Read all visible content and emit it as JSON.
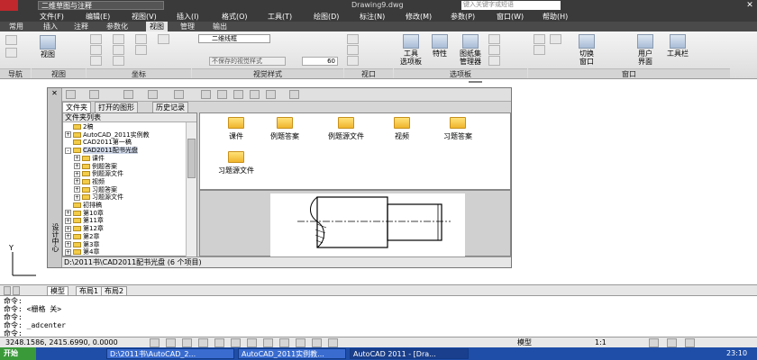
{
  "titlebar": {
    "workspace": "二维草图与注释",
    "doc": "Drawing9.dwg",
    "search_placeholder": "键入关键字或短语"
  },
  "menu": [
    "文件(F)",
    "编辑(E)",
    "视图(V)",
    "插入(I)",
    "格式(O)",
    "工具(T)",
    "绘图(D)",
    "标注(N)",
    "修改(M)",
    "参数(P)",
    "窗口(W)",
    "帮助(H)"
  ],
  "ribbon_tabs": [
    "常用",
    "插入",
    "注释",
    "参数化",
    "视图",
    "管理",
    "输出"
  ],
  "ribbon": {
    "groups": [
      "导航",
      "视图",
      "坐标",
      "视觉样式",
      "视口",
      "选项板",
      "窗口"
    ],
    "view_btn": "视图",
    "visual_style": "二维线框",
    "unsaved_style": "不保存的视觉样式",
    "opacity": "60",
    "tool_palette": "工具\n选项板",
    "properties": "特性",
    "sheet_set": "图纸集\n管理器",
    "switch_window": "切换\n窗口",
    "user_interface": "用户\n界面",
    "toolbar": "工具栏"
  },
  "dc": {
    "side_label": "设计中心",
    "tabs": [
      "文件夹",
      "打开的图形",
      "历史记录"
    ],
    "tree_header": "文件夹列表",
    "tree": [
      {
        "label": "2稿",
        "pm": "",
        "indent": 1
      },
      {
        "label": "AutoCAD_2011实例教",
        "pm": "+",
        "indent": 1
      },
      {
        "label": "CAD2011第一稿",
        "pm": "",
        "indent": 1
      },
      {
        "label": "CAD2011配书光盘",
        "pm": "-",
        "indent": 1
      },
      {
        "label": "课件",
        "pm": "+",
        "indent": 2
      },
      {
        "label": "例题答案",
        "pm": "+",
        "indent": 2
      },
      {
        "label": "例题源文件",
        "pm": "+",
        "indent": 2
      },
      {
        "label": "视频",
        "pm": "+",
        "indent": 2
      },
      {
        "label": "习题答案",
        "pm": "+",
        "indent": 2
      },
      {
        "label": "习题源文件",
        "pm": "+",
        "indent": 2
      },
      {
        "label": "初排稿",
        "pm": "",
        "indent": 1
      },
      {
        "label": "第10章",
        "pm": "+",
        "indent": 1
      },
      {
        "label": "第11章",
        "pm": "+",
        "indent": 1
      },
      {
        "label": "第12章",
        "pm": "+",
        "indent": 1
      },
      {
        "label": "第2章",
        "pm": "+",
        "indent": 1
      },
      {
        "label": "第3章",
        "pm": "+",
        "indent": 1
      },
      {
        "label": "第4章",
        "pm": "+",
        "indent": 1
      }
    ],
    "folders": [
      "课件",
      "例题答案",
      "例题源文件",
      "视频",
      "习题答案",
      "习题源文件"
    ],
    "status": "D:\\2011书\\CAD2011配书光盘 (6 个项目)"
  },
  "layout_tabs": [
    "模型",
    "布局1",
    "布局2"
  ],
  "cmd": [
    "命令:",
    "命令: <栅格 关>",
    "命令:",
    "命令: _adcenter",
    "命令:"
  ],
  "status": {
    "coords": "3248.1586, 2415.6990, 0.0000",
    "model": "模型",
    "scale": "1:1",
    "time": "23:10"
  },
  "taskbar": {
    "start": "开始",
    "tasks": [
      "D:\\2011书\\AutoCAD_2...",
      "AutoCAD_2011实例教...",
      "AutoCAD 2011 - [Dra..."
    ]
  }
}
